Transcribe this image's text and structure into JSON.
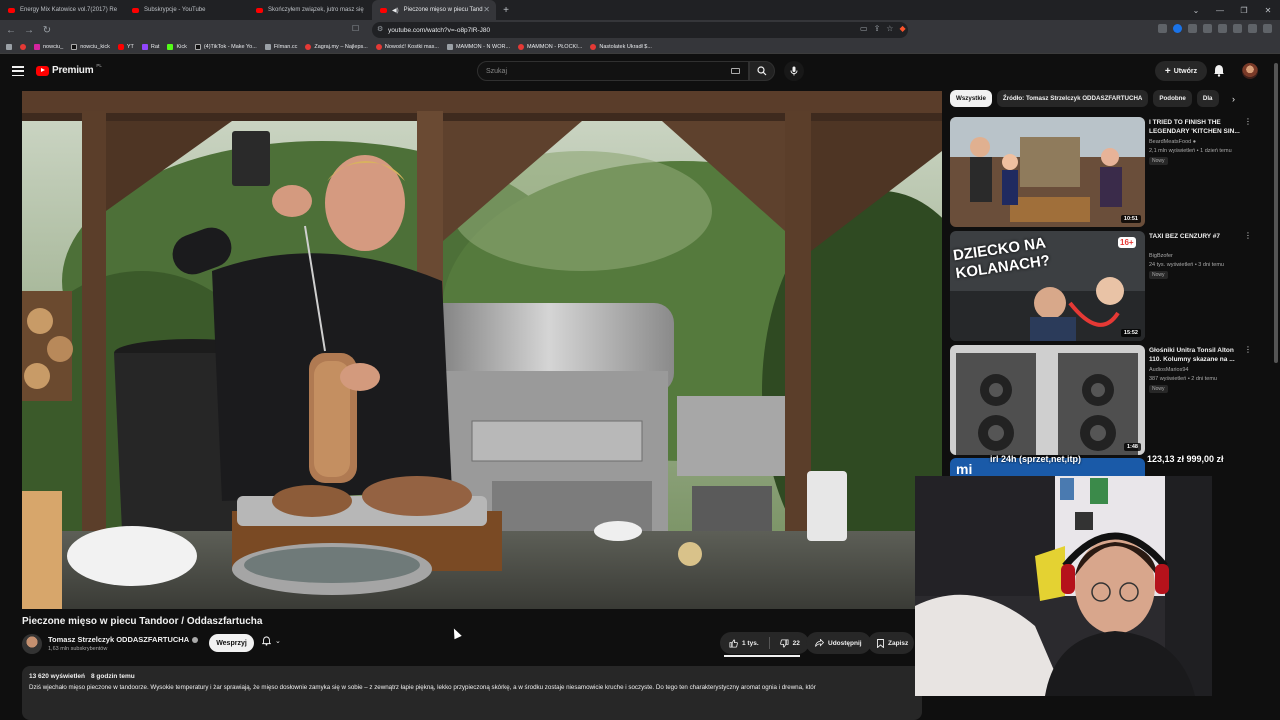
{
  "browser": {
    "tabs": [
      {
        "title": "Energy Mix Katowice vol.7(2017) Re",
        "active": false
      },
      {
        "title": "Subskrypcje - YouTube",
        "active": false
      },
      {
        "title": "Skończyłem związek, jutro masz się",
        "active": false
      },
      {
        "title": "Pieczone mięso w piecu Tand",
        "active": true
      }
    ],
    "new_tab": "+",
    "url": "youtube.com/watch?v=-o8p7lR-J80",
    "bookmarks": [
      {
        "label": "",
        "icon": "apps-icon"
      },
      {
        "label": "",
        "icon": "folder-icon"
      },
      {
        "label": "nowciu_",
        "icon": "instagram-icon"
      },
      {
        "label": "nowciu_kick",
        "icon": "x-icon"
      },
      {
        "label": "YT",
        "icon": "youtube-icon"
      },
      {
        "label": "Rat",
        "icon": "twitch-icon"
      },
      {
        "label": "Kick",
        "icon": "kick-icon"
      },
      {
        "label": "(4)TikTok - Make Yo...",
        "icon": "tiktok-icon"
      },
      {
        "label": "Filman.cc",
        "icon": "film-icon"
      },
      {
        "label": "Zagraj.my – Najleps...",
        "icon": "game-icon"
      },
      {
        "label": "Nowość! Kostki mas...",
        "icon": "red-icon"
      },
      {
        "label": "MAMMON - N WOR...",
        "icon": "github-icon"
      },
      {
        "label": "MAMMON - PŁOCKI...",
        "icon": "red-icon"
      },
      {
        "label": "Nastolatek Ukradł $...",
        "icon": "red-icon"
      }
    ]
  },
  "masthead": {
    "logo_word": "Premium",
    "logo_country": "PL",
    "search_placeholder": "Szukaj",
    "create_label": "Utwórz"
  },
  "video": {
    "title": "Pieczone mięso w piecu Tandoor / Oddaszfartucha",
    "channel": "Tomasz Strzelczyk ODDASZFARTUCHA",
    "subscribers": "1,63 mln subskrybentów",
    "support_label": "Wesprzyj",
    "likes": "1 tys.",
    "dislikes": "22",
    "share_label": "Udostępnij",
    "save_label": "Zapisz",
    "views": "13 620 wyświetleń",
    "age": "8 godzin temu",
    "description": "Dziś wjechało mięso pieczone w tandoorze. Wysokie temperatury i żar sprawiają, że mięso dosłownie zamyka się w sobie – z zewnątrz łapie piękną, lekko przypieczoną skórkę, a w środku zostaje niesamowicie kruche i soczyste. Do tego ten charakterystyczny aromat ognia i drewna, któr"
  },
  "sidebar": {
    "chips": [
      "Wszystkie",
      "Źródło: Tomasz Strzelczyk ODDASZFARTUCHA",
      "Podobne",
      "Dla"
    ],
    "active_chip": 0,
    "videos": [
      {
        "title": "I TRIED TO FINISH THE LEGENDARY 'KITCHEN SIN...",
        "channel": "BeardMeatsFood",
        "meta": "2,1 mln wyświetleń • 1 dzień temu",
        "badge": "Nowy",
        "duration": "10:51"
      },
      {
        "title": "TAXI BEZ CENZURY #7",
        "channel": "BigBzofer",
        "meta": "24 tys. wyświetleń • 3 dni temu",
        "badge": "Nowy",
        "duration": "15:52",
        "thumb_text": "DZIECKO NA KOLANACH?",
        "thumb_badge": "16+"
      },
      {
        "title": "Głośniki Unitra Tonsil Alton 110. Kolumny skazane na ...",
        "channel": "AudiosMarios94",
        "meta": "387 wyświetleń • 2 dni temu",
        "badge": "Nowy",
        "duration": "1:48"
      }
    ]
  },
  "overlay": {
    "ticker_left": "irl 24h (sprzet,net,itp)",
    "ticker_right": "123,13 zł  999,00 zł",
    "strip_text": "mi"
  },
  "colors": {
    "background": "#0f0f0f",
    "brand_red": "#ff0000",
    "surface": "#272727",
    "text": "#f1f1f1",
    "muted": "#aaaaaa"
  }
}
